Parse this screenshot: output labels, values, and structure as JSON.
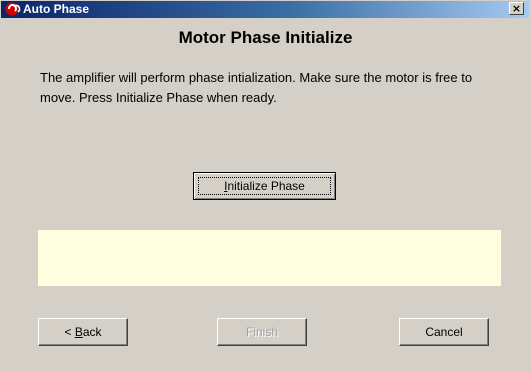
{
  "window": {
    "title": "Auto Phase",
    "close_glyph": "×"
  },
  "content": {
    "heading": "Motor Phase Initialize",
    "description": "The amplifier will perform phase intialization. Make sure the motor is free to move. Press Initialize Phase when ready."
  },
  "buttons": {
    "initialize_mnemonic": "I",
    "initialize_rest": "nitialize Phase",
    "back_prefix": "< ",
    "back_mnemonic": "B",
    "back_rest": "ack",
    "finish": "Finish",
    "cancel": "Cancel"
  },
  "status": {
    "message": ""
  },
  "colors": {
    "titlebar_start": "#0a246a",
    "titlebar_end": "#a6caf0",
    "dialog_bg": "#d4d0c8",
    "status_bg": "#ffffe0",
    "disabled_text": "#a0a0a0"
  },
  "icons": {
    "app": "app-logo-icon",
    "close": "close-icon"
  }
}
